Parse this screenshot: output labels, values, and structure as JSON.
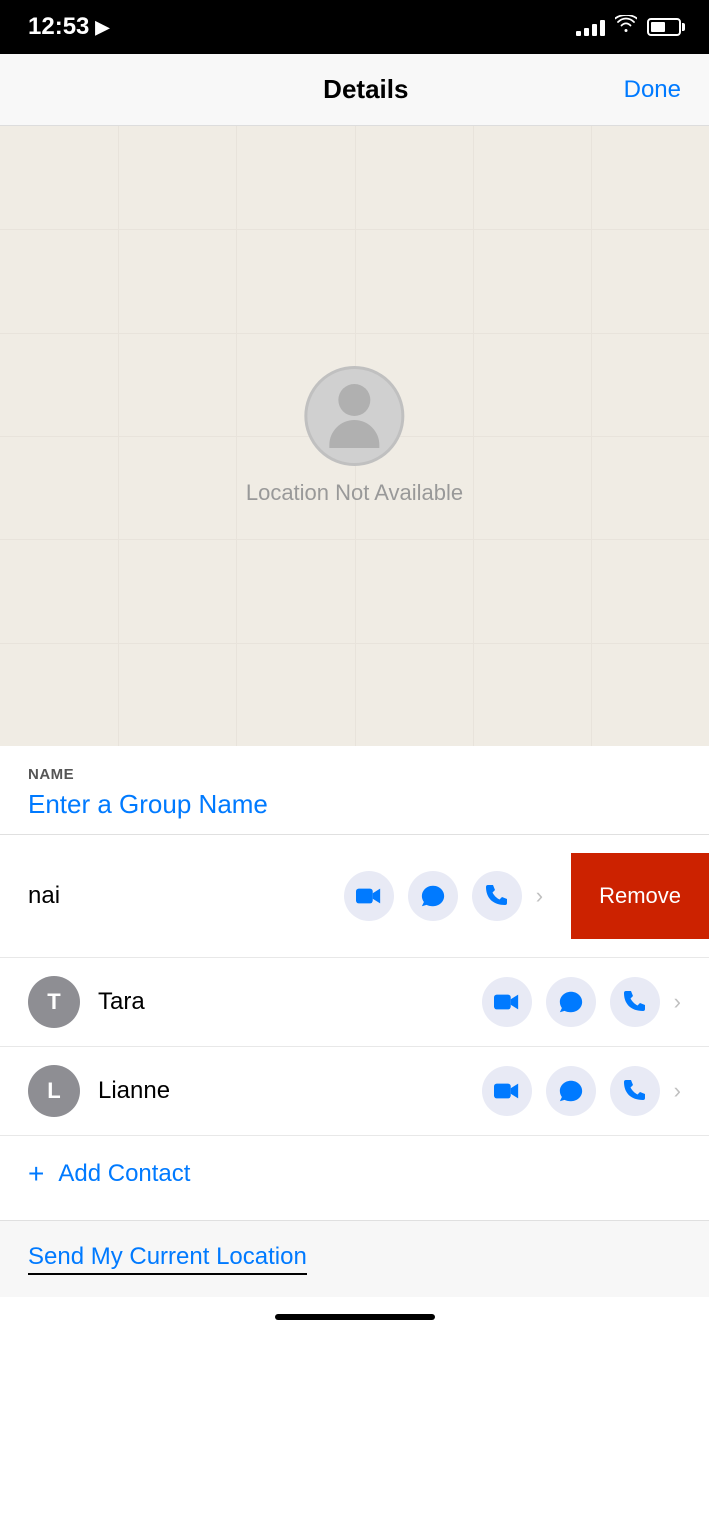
{
  "statusBar": {
    "time": "12:53",
    "locationIcon": "▶"
  },
  "navBar": {
    "title": "Details",
    "doneLabel": "Done"
  },
  "map": {
    "locationUnavailableText": "Location Not Available"
  },
  "nameSection": {
    "label": "NAME",
    "placeholder": "Enter a Group Name"
  },
  "contacts": [
    {
      "id": "hai",
      "name": "nai",
      "avatarLetter": "",
      "avatarColor": "",
      "swiped": true,
      "removeLabel": "Remove"
    },
    {
      "id": "tara",
      "name": "Tara",
      "avatarLetter": "T",
      "avatarColor": "#8e8e93",
      "swiped": false
    },
    {
      "id": "lianne",
      "name": "Lianne",
      "avatarLetter": "L",
      "avatarColor": "#8e8e93",
      "swiped": false
    }
  ],
  "addContact": {
    "plusIcon": "+",
    "label": "Add Contact"
  },
  "sendLocation": {
    "label": "Send My Current Location"
  }
}
